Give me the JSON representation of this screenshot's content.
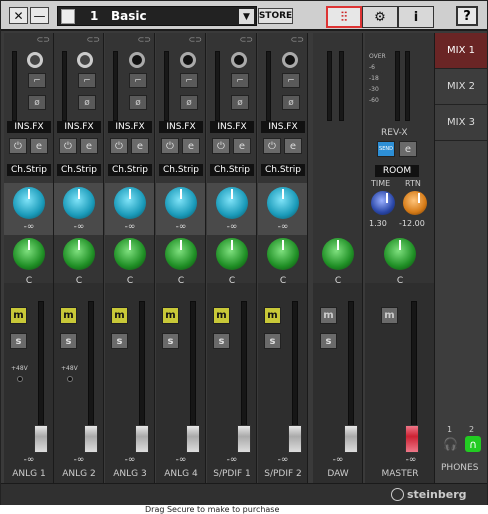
{
  "toolbar": {
    "preset_number": "1",
    "preset_name": "Basic",
    "store_label": "STORE",
    "info_label": "i",
    "help_label": "?"
  },
  "channels": [
    {
      "name": "ANLG 1",
      "label": "INS.FX",
      "strip": "Ch.Strip",
      "mute": "m",
      "solo": "s",
      "pan_value": "-∞",
      "send_value": "C",
      "fader_value": "-∞",
      "p48": "+48V"
    },
    {
      "name": "ANLG 2",
      "label": "INS.FX",
      "strip": "Ch.Strip",
      "mute": "m",
      "solo": "s",
      "pan_value": "-∞",
      "send_value": "C",
      "fader_value": "-∞",
      "p48": "+48V"
    },
    {
      "name": "ANLG 3",
      "label": "INS.FX",
      "strip": "Ch.Strip",
      "mute": "m",
      "solo": "s",
      "pan_value": "-∞",
      "send_value": "C",
      "fader_value": "-∞"
    },
    {
      "name": "ANLG 4",
      "label": "INS.FX",
      "strip": "Ch.Strip",
      "mute": "m",
      "solo": "s",
      "pan_value": "-∞",
      "send_value": "C",
      "fader_value": "-∞"
    },
    {
      "name": "S/PDIF 1",
      "label": "INS.FX",
      "strip": "Ch.Strip",
      "mute": "m",
      "solo": "s",
      "pan_value": "-∞",
      "send_value": "C",
      "fader_value": "-∞"
    },
    {
      "name": "S/PDIF 2",
      "label": "INS.FX",
      "strip": "Ch.Strip",
      "mute": "m",
      "solo": "s",
      "pan_value": "-∞",
      "send_value": "C",
      "fader_value": "-∞"
    }
  ],
  "daw": {
    "name": "DAW",
    "mute": "m",
    "solo": "s",
    "send_value": "C",
    "fader_value": "-∞"
  },
  "master": {
    "name": "MASTER",
    "mute": "m",
    "send_value": "C",
    "fader_value": "-∞",
    "meter_scale": [
      "OVER",
      "-6",
      "-18",
      "-30",
      "-60"
    ],
    "rev_label": "REV-X",
    "send_label": "SEND",
    "room_label": "ROOM",
    "time_label": "TIME",
    "rtn_label": "RTN",
    "time_value": "1.30",
    "rtn_value": "-12.00"
  },
  "mix_tabs": [
    "MIX 1",
    "MIX 2",
    "MIX 3"
  ],
  "phones": {
    "label": "PHONES",
    "ch1": "1",
    "ch2": "2"
  },
  "brand": "steinberg",
  "footnote": "Drag Secure to make to purchase"
}
